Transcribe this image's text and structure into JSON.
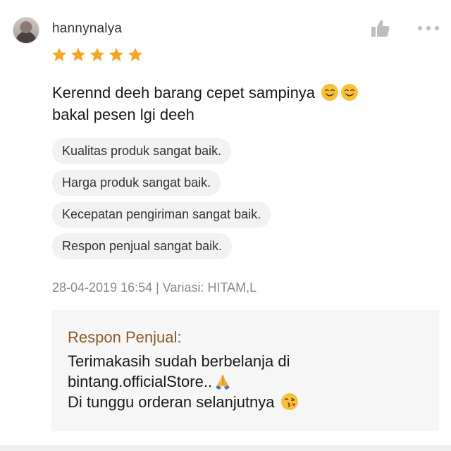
{
  "review": {
    "username": "hannynalya",
    "rating": 5,
    "rating_max": 5,
    "comment_lines": [
      {
        "text": "Kerennd deeh barang cepet sampinya",
        "emojis": [
          "smiling-face-icon",
          "smiling-face-icon"
        ]
      },
      {
        "text": "bakal pesen lgi deeh",
        "emojis": []
      }
    ],
    "tags": [
      "Kualitas produk sangat baik.",
      "Harga produk sangat baik.",
      "Kecepatan pengiriman sangat baik.",
      "Respon penjual sangat baik."
    ],
    "meta": "28-04-2019 16:54 | Variasi: HITAM,L",
    "seller_response": {
      "title": "Respon Penjual:",
      "lines": [
        "Terimakasih sudah berbelanja di",
        "bintang.officialStore..",
        "Di tunggu orderan selanjutnya"
      ]
    }
  },
  "icons": {
    "like": "thumbs-up-icon",
    "more": "more-dots-icon",
    "star": "star-icon"
  },
  "colors": {
    "star": "#f5a623",
    "seller_title": "#8b5a2b",
    "tag_bg": "#f2f2f2",
    "response_bg": "#f6f6f6",
    "meta_text": "#8a8a8a",
    "icon_gray": "#bdbdbd"
  }
}
